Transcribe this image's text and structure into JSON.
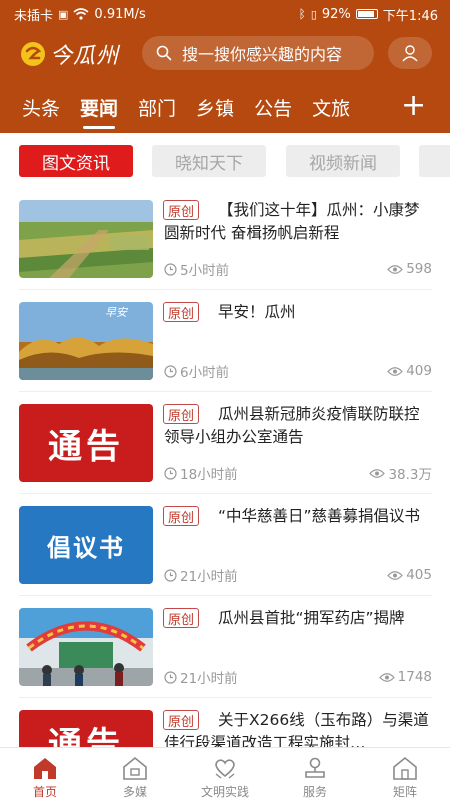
{
  "status_bar": {
    "carrier": "未插卡",
    "speed": "0.91M/s",
    "battery": "92%",
    "battery_level": 0.92,
    "time": "下午1:46"
  },
  "header": {
    "logo_text": "今瓜州",
    "search_placeholder": "搜一搜你感兴趣的内容",
    "brand_color": "#b5490f"
  },
  "tabs": [
    {
      "label": "头条"
    },
    {
      "label": "要闻",
      "active": true
    },
    {
      "label": "部门"
    },
    {
      "label": "乡镇"
    },
    {
      "label": "公告"
    },
    {
      "label": "文旅"
    }
  ],
  "tab_add_label": "+",
  "chips": [
    {
      "label": "图文资讯",
      "active": true
    },
    {
      "label": "晓知天下"
    },
    {
      "label": "视频新闻"
    }
  ],
  "articles": [
    {
      "badge": "原创",
      "title": "【我们这十年】瓜州：小康梦圆新时代 奋楫扬帆启新程",
      "time": "5小时前",
      "views": "598",
      "thumb": "farmland"
    },
    {
      "badge": "原创",
      "title": "早安！瓜州",
      "time": "6小时前",
      "views": "409",
      "thumb": "autumn-trees",
      "thumb_text": "早安"
    },
    {
      "badge": "原创",
      "title": "瓜州县新冠肺炎疫情联防联控领导小组办公室通告",
      "time": "18小时前",
      "views": "38.3万",
      "thumb": "notice",
      "thumb_text": "通告"
    },
    {
      "badge": "原创",
      "title": "“中华慈善日”慈善募捐倡议书",
      "time": "21小时前",
      "views": "405",
      "thumb": "proposal",
      "thumb_text": "倡议书"
    },
    {
      "badge": "原创",
      "title": "瓜州县首批“拥军药店”揭牌",
      "time": "21小时前",
      "views": "1748",
      "thumb": "pharmacy"
    },
    {
      "badge": "原创",
      "title": "关于X266线（玉布路）与渠道佳行段渠道改造工程实施封…",
      "time": "",
      "views": "",
      "thumb": "notice",
      "thumb_text": "通告"
    }
  ],
  "bottom_nav": [
    {
      "label": "首页",
      "icon": "home-icon",
      "active": true
    },
    {
      "label": "多媒",
      "icon": "media-house-icon"
    },
    {
      "label": "文明实践",
      "icon": "heart-hands-icon"
    },
    {
      "label": "服务",
      "icon": "service-icon"
    },
    {
      "label": "矩阵",
      "icon": "matrix-house-icon"
    }
  ]
}
